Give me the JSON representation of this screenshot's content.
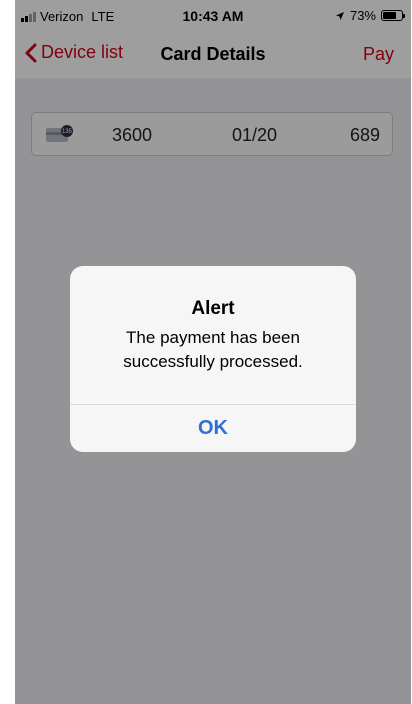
{
  "status_bar": {
    "carrier": "Verizon",
    "network": "LTE",
    "time": "10:43 AM",
    "battery_percent": "73%",
    "battery_level": 0.73,
    "location_icon": "location-arrow-icon"
  },
  "nav": {
    "back_label": "Device list",
    "title": "Card Details",
    "pay_label": "Pay",
    "accent_color": "#d0021b"
  },
  "card": {
    "icon_badge": "135",
    "number": "3600",
    "expiry": "01/20",
    "cvv": "689"
  },
  "alert": {
    "title": "Alert",
    "message": "The payment has been successfully processed.",
    "button_label": "OK",
    "button_color": "#2f6fd6"
  }
}
